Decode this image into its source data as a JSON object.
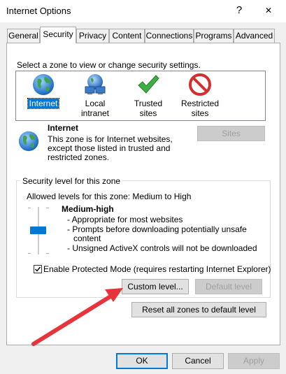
{
  "window": {
    "title": "Internet Options",
    "help_glyph": "?",
    "close_glyph": "✕"
  },
  "tabs": [
    {
      "label": "General"
    },
    {
      "label": "Security"
    },
    {
      "label": "Privacy"
    },
    {
      "label": "Content"
    },
    {
      "label": "Connections"
    },
    {
      "label": "Programs"
    },
    {
      "label": "Advanced"
    }
  ],
  "active_tab": "Security",
  "zones": {
    "prompt": "Select a zone to view or change security settings.",
    "items": [
      {
        "label": "Internet",
        "icon": "globe-icon",
        "selected": true
      },
      {
        "label": "Local intranet",
        "icon": "intranet-icon",
        "selected": false
      },
      {
        "label": "Trusted sites",
        "icon": "checkmark-icon",
        "selected": false
      },
      {
        "label": "Restricted sites",
        "icon": "restricted-icon",
        "selected": false
      }
    ]
  },
  "selected_zone": {
    "title": "Internet",
    "description": "This zone is for Internet websites, except those listed in trusted and restricted zones.",
    "sites_button": "Sites"
  },
  "security_level": {
    "group_title": "Security level for this zone",
    "allowed": "Allowed levels for this zone: Medium to High",
    "level_name": "Medium-high",
    "bullets": [
      "- Appropriate for most websites",
      "- Prompts before downloading potentially unsafe",
      "content",
      "- Unsigned ActiveX controls will not be downloaded"
    ],
    "protected_mode_label": "Enable Protected Mode (requires restarting Internet Explorer)",
    "protected_mode_checked": true,
    "custom_level_button": "Custom level...",
    "default_level_button": "Default level"
  },
  "reset_all_button": "Reset all zones to default level",
  "footer": {
    "ok": "OK",
    "cancel": "Cancel",
    "apply": "Apply"
  },
  "colors": {
    "selection": "#0078d7",
    "annotation_arrow": "#e8333a"
  }
}
